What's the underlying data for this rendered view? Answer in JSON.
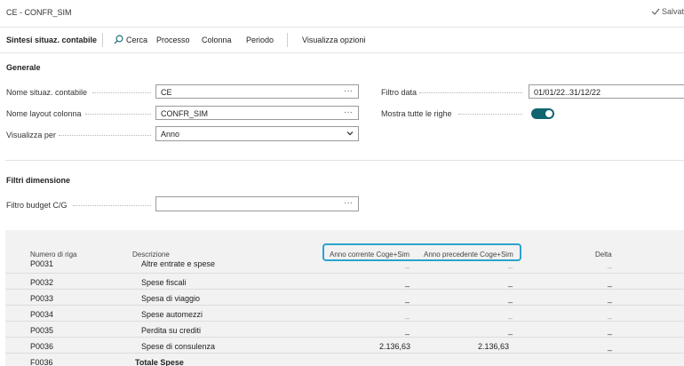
{
  "window": {
    "title": "CE - CONFR_SIM",
    "saved_label": "Salvat"
  },
  "actionbar": {
    "page_name": "Sintesi situaz. contabile",
    "search_label": "Cerca",
    "process_label": "Processo",
    "column_label": "Colonna",
    "period_label": "Periodo",
    "show_options_label": "Visualizza opzioni"
  },
  "general": {
    "section_title": "Generale",
    "sched_name_label": "Nome situaz. contabile",
    "sched_name_value": "CE",
    "layout_label": "Nome layout colonna",
    "layout_value": "CONFR_SIM",
    "view_by_label": "Visualizza per",
    "view_by_value": "Anno",
    "date_filter_label": "Filtro data",
    "date_filter_value": "01/01/22..31/12/22",
    "show_all_lines_label": "Mostra tutte le righe",
    "show_all_lines_on": true
  },
  "dimensions": {
    "section_title": "Filtri dimensione",
    "budget_filter_label": "Filtro budget C/G",
    "budget_filter_value": ""
  },
  "grid": {
    "headers": {
      "row_no": "Numero di riga",
      "description": "Descrizione",
      "current_year": "Anno corrente Coge+Sim",
      "previous_year": "Anno precedente Coge+Sim",
      "delta": "Delta"
    },
    "rows": [
      {
        "row_no": "P0031",
        "description": "Altre entrate e spese",
        "current": "_",
        "previous": "_",
        "delta": "_",
        "bold": false,
        "faint": true
      },
      {
        "row_no": "P0032",
        "description": "Spese fiscali",
        "current": "_",
        "previous": "_",
        "delta": "_",
        "bold": false,
        "faint": false
      },
      {
        "row_no": "P0033",
        "description": "Spesa di viaggio",
        "current": "_",
        "previous": "_",
        "delta": "_",
        "bold": false,
        "faint": false
      },
      {
        "row_no": "P0034",
        "description": "Spese automezzi",
        "current": "_",
        "previous": "_",
        "delta": "_",
        "bold": false,
        "faint": true
      },
      {
        "row_no": "P0035",
        "description": "Perdita su crediti",
        "current": "_",
        "previous": "_",
        "delta": "_",
        "bold": false,
        "faint": false
      },
      {
        "row_no": "P0036",
        "description": "Spese di consulenza",
        "current": "2.136,63",
        "previous": "2.136,63",
        "delta": "_",
        "bold": false,
        "faint": false
      },
      {
        "row_no": "F0036",
        "description": "Totale Spese",
        "current": "_",
        "previous": "_",
        "delta": "_",
        "bold": true,
        "faint": true
      }
    ]
  },
  "colors": {
    "accent": "#0f6570",
    "highlight": "#2aa3cf"
  }
}
